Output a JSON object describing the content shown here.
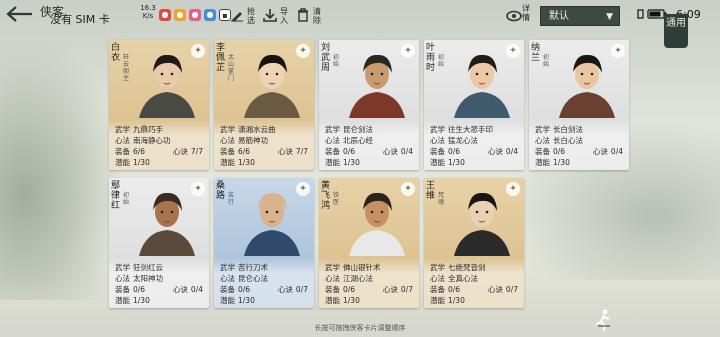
{
  "header": {
    "title": "侠客",
    "carrier": "没有 SIM 卡",
    "net_speed": "16.3",
    "net_unit": "K/s",
    "tools": [
      {
        "label": "抢选"
      },
      {
        "label": "导入"
      },
      {
        "label": "清除"
      }
    ],
    "detail_label": "详情",
    "sort_value": "默认",
    "time": "6:09",
    "apply_label": "通用"
  },
  "cards": [
    {
      "name": "白衣",
      "title": "轩云阁主",
      "theme": "tan",
      "skill_label": "武学",
      "skill": "九鼎巧手",
      "heart_label": "心法",
      "heart": "南海静心功",
      "equip_label": "装备",
      "equip": "6/6",
      "mantra_label": "心诀",
      "mantra": "7/7",
      "potential_label": "潜能",
      "potential": "1/30"
    },
    {
      "name": "李佩芷",
      "title": "太山掌门",
      "theme": "tan",
      "skill_label": "武学",
      "skill": "潇湘水云曲",
      "heart_label": "心法",
      "heart": "易筋神功",
      "equip_label": "装备",
      "equip": "6/6",
      "mantra_label": "心诀",
      "mantra": "7/7",
      "potential_label": "潜能",
      "potential": "1/30"
    },
    {
      "name": "刘武周",
      "title": "初始",
      "theme": "grey",
      "skill_label": "武学",
      "skill": "昆仑剑法",
      "heart_label": "心法",
      "heart": "北辰心经",
      "equip_label": "装备",
      "equip": "0/6",
      "mantra_label": "心诀",
      "mantra": "0/4",
      "potential_label": "潜能",
      "potential": "1/30"
    },
    {
      "name": "叶雨时",
      "title": "初始",
      "theme": "grey",
      "skill_label": "武学",
      "skill": "往生大悲手印",
      "heart_label": "心法",
      "heart": "猛龙心法",
      "equip_label": "装备",
      "equip": "0/6",
      "mantra_label": "心诀",
      "mantra": "0/4",
      "potential_label": "潜能",
      "potential": "1/30"
    },
    {
      "name": "纳兰",
      "title": "初始",
      "theme": "grey",
      "skill_label": "武学",
      "skill": "长白剑法",
      "heart_label": "心法",
      "heart": "长白心法",
      "equip_label": "装备",
      "equip": "0/6",
      "mantra_label": "心诀",
      "mantra": "0/4",
      "potential_label": "潜能",
      "potential": "1/30"
    },
    {
      "name": "鄢律红",
      "title": "初始",
      "theme": "grey",
      "skill_label": "武学",
      "skill": "狂剑红云",
      "heart_label": "心法",
      "heart": "太阳神功",
      "equip_label": "装备",
      "equip": "0/6",
      "mantra_label": "心诀",
      "mantra": "0/4",
      "potential_label": "潜能",
      "potential": "1/30"
    },
    {
      "name": "桑路",
      "title": "苦行",
      "theme": "blue",
      "skill_label": "武学",
      "skill": "苦行刀术",
      "heart_label": "心法",
      "heart": "昆仑心法",
      "equip_label": "装备",
      "equip": "0/6",
      "mantra_label": "心诀",
      "mantra": "0/7",
      "potential_label": "潜能",
      "potential": "1/30"
    },
    {
      "name": "黄飞鸿",
      "title": "铁医",
      "theme": "tan",
      "skill_label": "武学",
      "skill": "佛山银针术",
      "heart_label": "心法",
      "heart": "江湖心法",
      "equip_label": "装备",
      "equip": "0/6",
      "mantra_label": "心诀",
      "mantra": "0/7",
      "potential_label": "潜能",
      "potential": "1/30"
    },
    {
      "name": "王维",
      "title": "梵魂",
      "theme": "tan",
      "skill_label": "武学",
      "skill": "七绝梵音剑",
      "heart_label": "心法",
      "heart": "全真心法",
      "equip_label": "装备",
      "equip": "0/6",
      "mantra_label": "心诀",
      "mantra": "0/7",
      "potential_label": "潜能",
      "potential": "1/30"
    }
  ],
  "footer": {
    "hint": "长按可拖拽侠客卡片调整顺序"
  },
  "colors": {
    "accent_dark": "#3d4a44",
    "card_tan": "#e7d2a8",
    "card_grey": "#ececec",
    "card_blue": "#c7d7e8"
  }
}
